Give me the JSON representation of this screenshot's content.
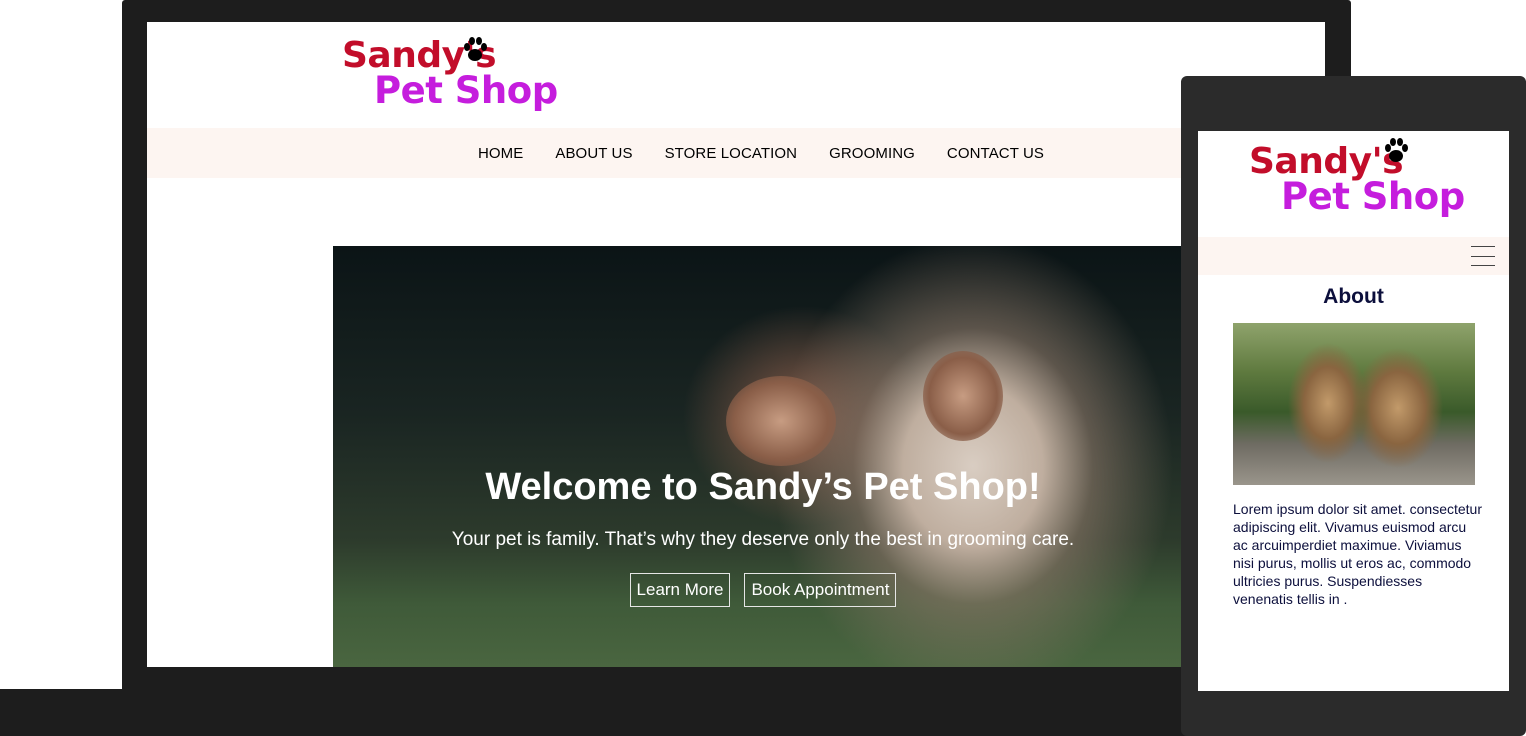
{
  "brand": {
    "line1": "Sandy's",
    "line2": "Pet Shop",
    "logo_colors": {
      "line1": "#c20d2a",
      "line2": "#c51ddd"
    },
    "paw_icon": "paw-print-icon"
  },
  "desktop": {
    "nav": {
      "background": "#fdf5f1",
      "items": [
        "HOME",
        "ABOUT US",
        "STORE LOCATION",
        "GROOMING",
        "CONTACT US"
      ]
    },
    "hero": {
      "title": "Welcome to Sandy’s Pet Shop!",
      "subtitle": "Your pet is family. That’s why they deserve only the best in grooming care.",
      "buttons": [
        "Learn More",
        "Book Appointment"
      ]
    }
  },
  "mobile": {
    "menu_icon": "hamburger-menu-icon",
    "section_title": "About",
    "body_text": "Lorem ipsum dolor sit amet. consectetur adipiscing elit. Vivamus euismod arcu ac arcuimperdiet maximue. Viviamus nisi purus, mollis ut eros ac, commodo ultricies purus. Suspendiesses venenatis tellis in ."
  }
}
